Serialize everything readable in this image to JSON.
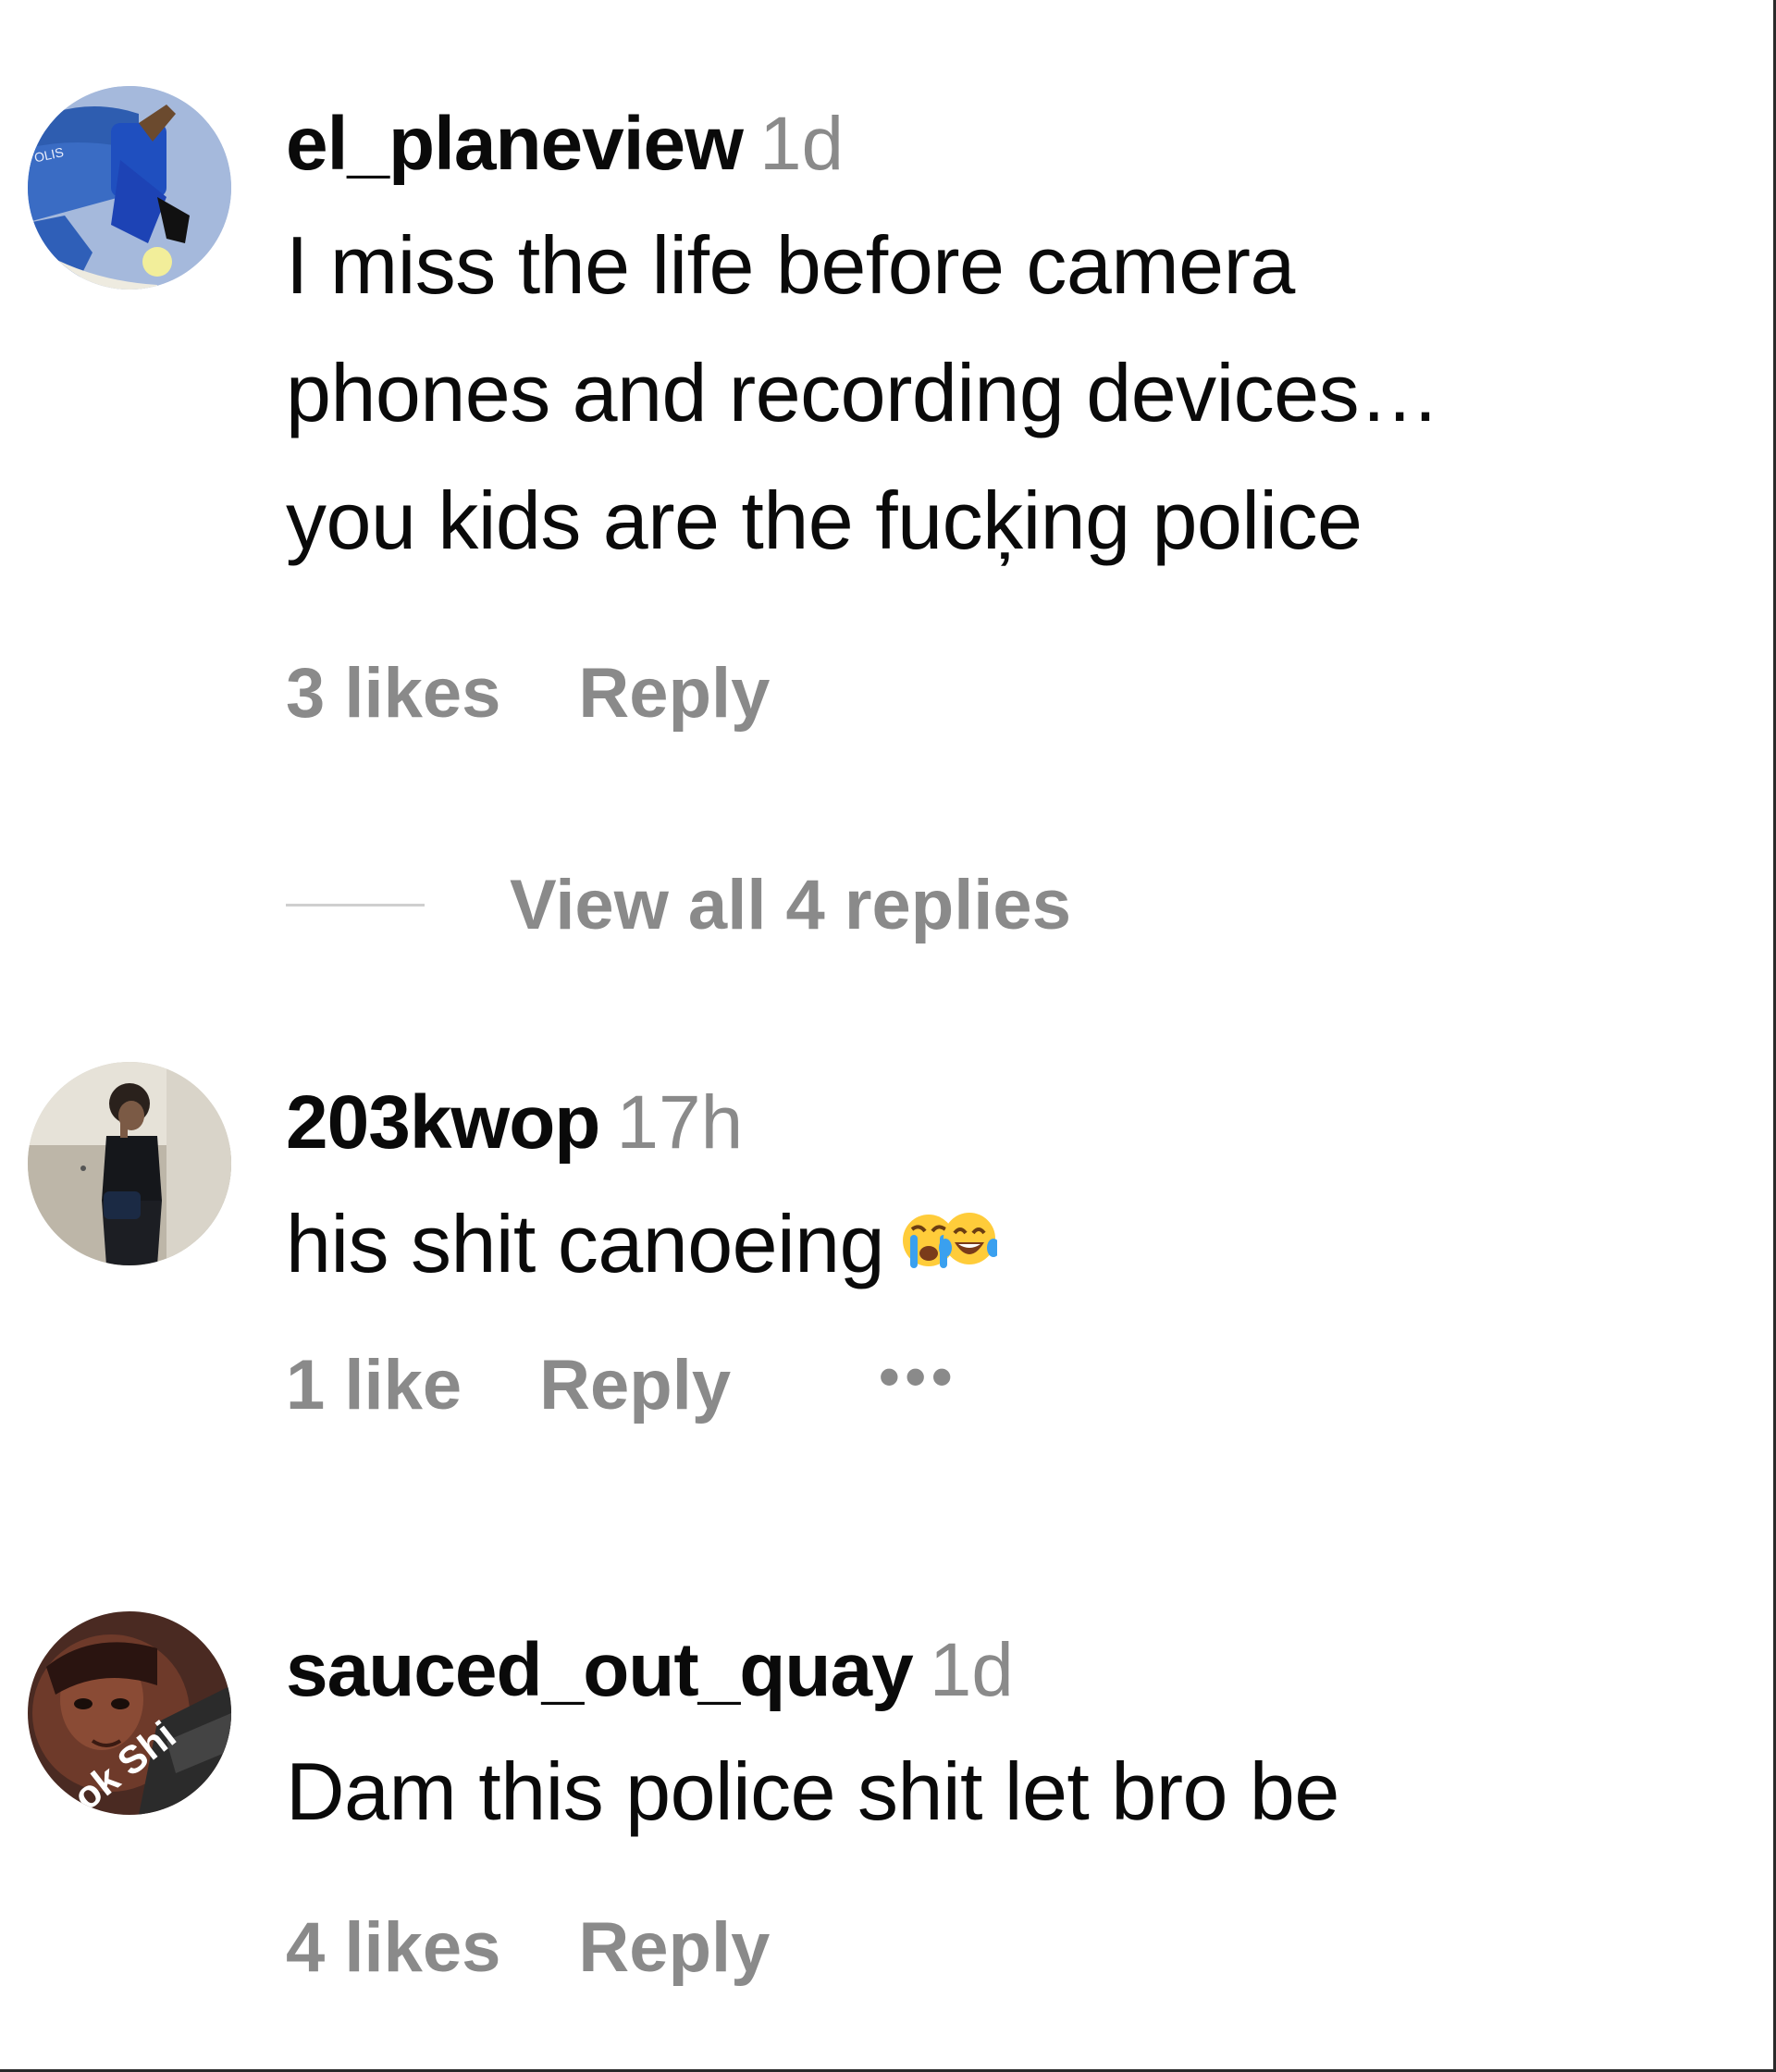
{
  "comments": [
    {
      "username": "el_planeview",
      "time": "1d",
      "text_lines": [
        "I miss the life before camera",
        "phones and recording devices…",
        "you kids are the fucķing police"
      ],
      "likes": "3 likes",
      "reply": "Reply",
      "avatar": "police-cartoon-avatar",
      "avatar_text": "OLIS"
    },
    {
      "username": "203kwop",
      "time": "17h",
      "text_lines": [
        "his shit canoeing"
      ],
      "emojis": [
        "loudly-crying-face-emoji",
        "tears-of-joy-face-emoji"
      ],
      "likes": "1 like",
      "reply": "Reply",
      "more": "•••",
      "avatar": "person-standing-photo-avatar"
    },
    {
      "username": "sauced_out_quay",
      "time": "1d",
      "text_lines": [
        "Dam this police shit let bro be"
      ],
      "likes": "4 likes",
      "reply": "Reply",
      "avatar": "face-with-text-avatar",
      "avatar_text": "ok Shi"
    }
  ],
  "view_replies": "View all 4 replies",
  "colors": {
    "primary_text": "#0a0a0a",
    "secondary_text": "#8a8a8a",
    "divider": "#cfcfcf",
    "background": "#ffffff"
  }
}
